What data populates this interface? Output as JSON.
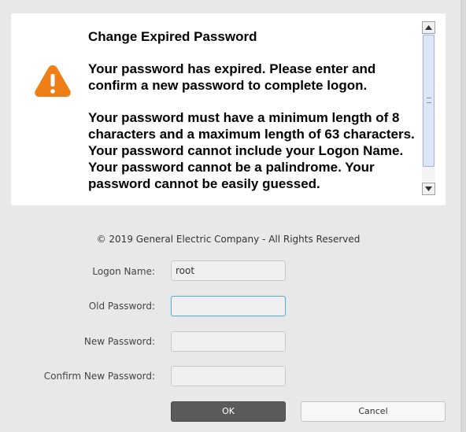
{
  "message": {
    "title": "Change Expired Password",
    "paragraph1": "Your password has expired. Please enter and confirm a new password to complete logon.",
    "paragraph2": "Your password must have a minimum length of 8 characters and a maximum length of 63 characters. Your password cannot include your Logon Name. Your password cannot be a palindrome. Your password cannot be easily guessed.",
    "icon": "warning-icon",
    "icon_color": "#ee7f16"
  },
  "copyright": "© 2019 General Electric Company - All Rights Reserved",
  "form": {
    "logon_name_label": "Logon Name:",
    "logon_name_value": "root",
    "old_password_label": "Old Password:",
    "new_password_label": "New Password:",
    "confirm_password_label": "Confirm New Password:"
  },
  "buttons": {
    "ok": "OK",
    "cancel": "Cancel"
  }
}
